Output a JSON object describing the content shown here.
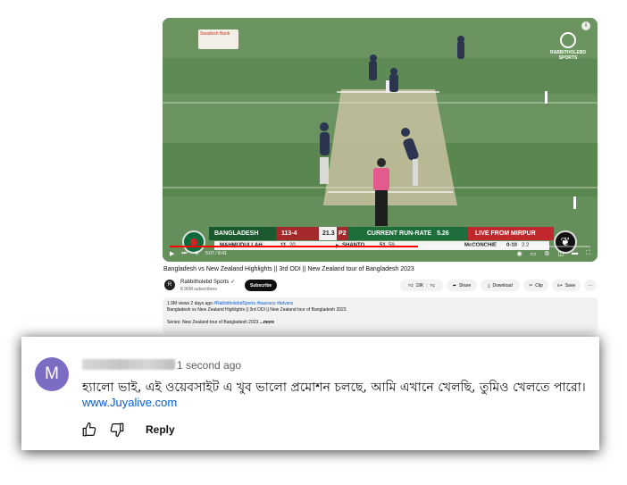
{
  "video": {
    "watermark": "RABBITHOLEBD SPORTS",
    "sponsor_logo_text": "Swadesh Bank",
    "info_icon": "info-icon",
    "scorecard": {
      "team": "BANGLADESH",
      "score": "113-4",
      "overs": "21.3",
      "period": "P2",
      "run_rate_label": "CURRENT RUN-RATE",
      "run_rate": "5.26",
      "live": "LIVE FROM MIRPUR",
      "batter1": "MAHMUDULLAH",
      "batter1_score": "11",
      "batter1_balls": "20",
      "batter2": "SHANTO",
      "batter2_score": "51",
      "batter2_balls": "59",
      "bowler": "McCONCHIE",
      "bowler_figures": "0-10",
      "bowler_overs": "2.2"
    },
    "time": "5:07 / 8:41",
    "progress": 0.59,
    "accent": "#ff0000"
  },
  "title": "Bangladesh vs New Zealand Highlights || 3rd ODI || New Zealand tour of Bangladesh 2023",
  "channel": {
    "avatar_letter": "R",
    "name": "Rabbitholebd Sports",
    "subscribers": "8.96M subscribers",
    "subscribe_label": "Subscribe"
  },
  "actions": {
    "likes": "19K",
    "share": "Share",
    "download": "Download",
    "clip": "Clip",
    "save": "Save"
  },
  "description": {
    "stats": "1.9M views  2 days ago",
    "tags": "#RabbitholebdSports #bazvsnz #bdvsnz",
    "line2": "Bangladesh vs New Zealand Highlights || 3rd ODI || New Zealand tour of Bangladesh 2023",
    "series": "Series: New Zealand tour of Bangladesh 2023",
    "more": "...more"
  },
  "comment": {
    "avatar_letter": "M",
    "time": "1 second ago",
    "text": "হ্যালো ভাই, এই ওয়েবসাইট এ খুব ভালো প্রমোশন চলছে, আমি এখানে খেলছি, তুমিও খেলতে পারো।",
    "link": "www.Juyalive.com",
    "reply": "Reply",
    "avatar_color": "#7c6cc4"
  }
}
